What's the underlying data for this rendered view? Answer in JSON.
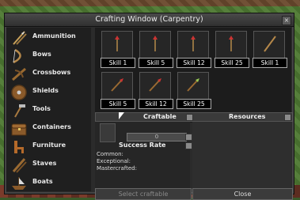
{
  "window": {
    "title": "Crafting Window (Carpentry)",
    "close_symbol": "×"
  },
  "categories": [
    {
      "label": "Ammunition",
      "icon": "arrows-icon"
    },
    {
      "label": "Bows",
      "icon": "bow-icon"
    },
    {
      "label": "Crossbows",
      "icon": "crossbow-icon"
    },
    {
      "label": "Shields",
      "icon": "shield-icon"
    },
    {
      "label": "Tools",
      "icon": "tools-icon"
    },
    {
      "label": "Containers",
      "icon": "chest-icon"
    },
    {
      "label": "Furniture",
      "icon": "chair-icon"
    },
    {
      "label": "Staves",
      "icon": "staff-icon"
    },
    {
      "label": "Boats",
      "icon": "boat-icon"
    }
  ],
  "items": [
    {
      "skill": "Skill 1",
      "icon": "arrow-icon"
    },
    {
      "skill": "Skill 5",
      "icon": "arrow-icon"
    },
    {
      "skill": "Skill 12",
      "icon": "arrow-icon"
    },
    {
      "skill": "Skill 25",
      "icon": "arrow-icon"
    },
    {
      "skill": "Skill 1",
      "icon": "shaft-icon"
    },
    {
      "skill": "Skill 5",
      "icon": "bolt-icon"
    },
    {
      "skill": "Skill 12",
      "icon": "bolt-icon"
    },
    {
      "skill": "Skill 25",
      "icon": "bolt-icon"
    }
  ],
  "craftable": {
    "header": "Craftable",
    "quantity": "0"
  },
  "resources": {
    "header": "Resources"
  },
  "success_rate": {
    "title": "Success Rate",
    "common": "Common:",
    "exceptional": "Exceptional:",
    "mastercrafted": "Mastercrafted:"
  },
  "buttons": {
    "select_craftable": "Select craftable",
    "close": "Close"
  }
}
